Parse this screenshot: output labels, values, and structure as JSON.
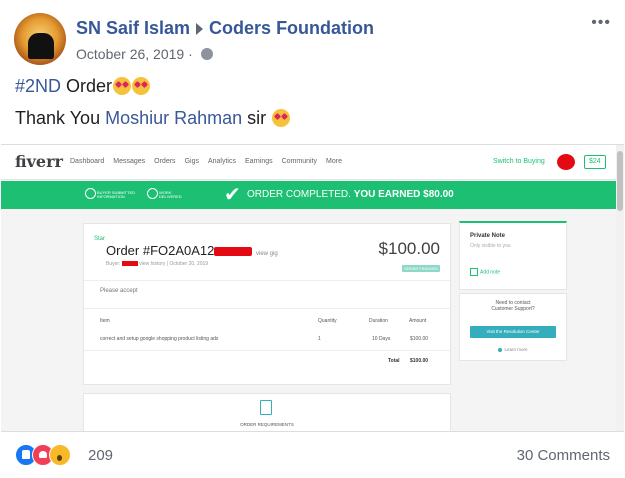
{
  "post": {
    "author": "SN Saif Islam",
    "group": "Coders Foundation",
    "date": "October 26, 2019",
    "date_sep": "·",
    "more": "•••",
    "line1": {
      "hashtag": "#2ND",
      "text": " Order"
    },
    "line2": {
      "prefix": "Thank You ",
      "mention": "Moshiur Rahman",
      "suffix": " sir "
    }
  },
  "fiverr": {
    "logo": "fiverr",
    "menu": [
      "Dashboard",
      "Messages",
      "Orders",
      "Gigs",
      "Analytics",
      "Earnings",
      "Community",
      "More"
    ],
    "switch": "Switch to Buying",
    "balance": "$24",
    "banner": {
      "step1": "BUYER SUBMITTED INFORMATION",
      "step2": "WORK DELIVERED",
      "message_a": "ORDER COMPLETED. ",
      "message_b": "YOU EARNED $80.00"
    },
    "order": {
      "star": "Star",
      "title": "Order #FO2A0A12",
      "view_gig": "view gig",
      "buyer": "Buyer:",
      "buyer_tail": "view history",
      "date": "October 20, 2019",
      "price": "$100.00",
      "status": "ORDER FINISHED",
      "note": "Please accept",
      "headers": {
        "item": "Item",
        "quantity": "Quantity",
        "duration": "Duration",
        "amount": "Amount"
      },
      "row": {
        "item": "correct and setup google shopping product listing ads",
        "quantity": "1",
        "duration": "10 Days",
        "amount": "$100.00"
      },
      "total_label": "Total",
      "total_value": "$100.00"
    },
    "private_note": {
      "title": "Private Note",
      "sub": "Only visible to you",
      "add": "Add note"
    },
    "support": {
      "line1": "Need to contact",
      "line2": "Customer Support?",
      "button": "Visit the Resolution Center",
      "learn": "Learn more"
    },
    "requirements": "ORDER REQUIREMENTS"
  },
  "footer": {
    "reactions": [
      "like-icon",
      "love-icon",
      "wow-icon"
    ],
    "reaction_count": "209",
    "comments": "30 Comments"
  },
  "colors": {
    "link": "#365899",
    "fiverr_green": "#1dbf73"
  }
}
